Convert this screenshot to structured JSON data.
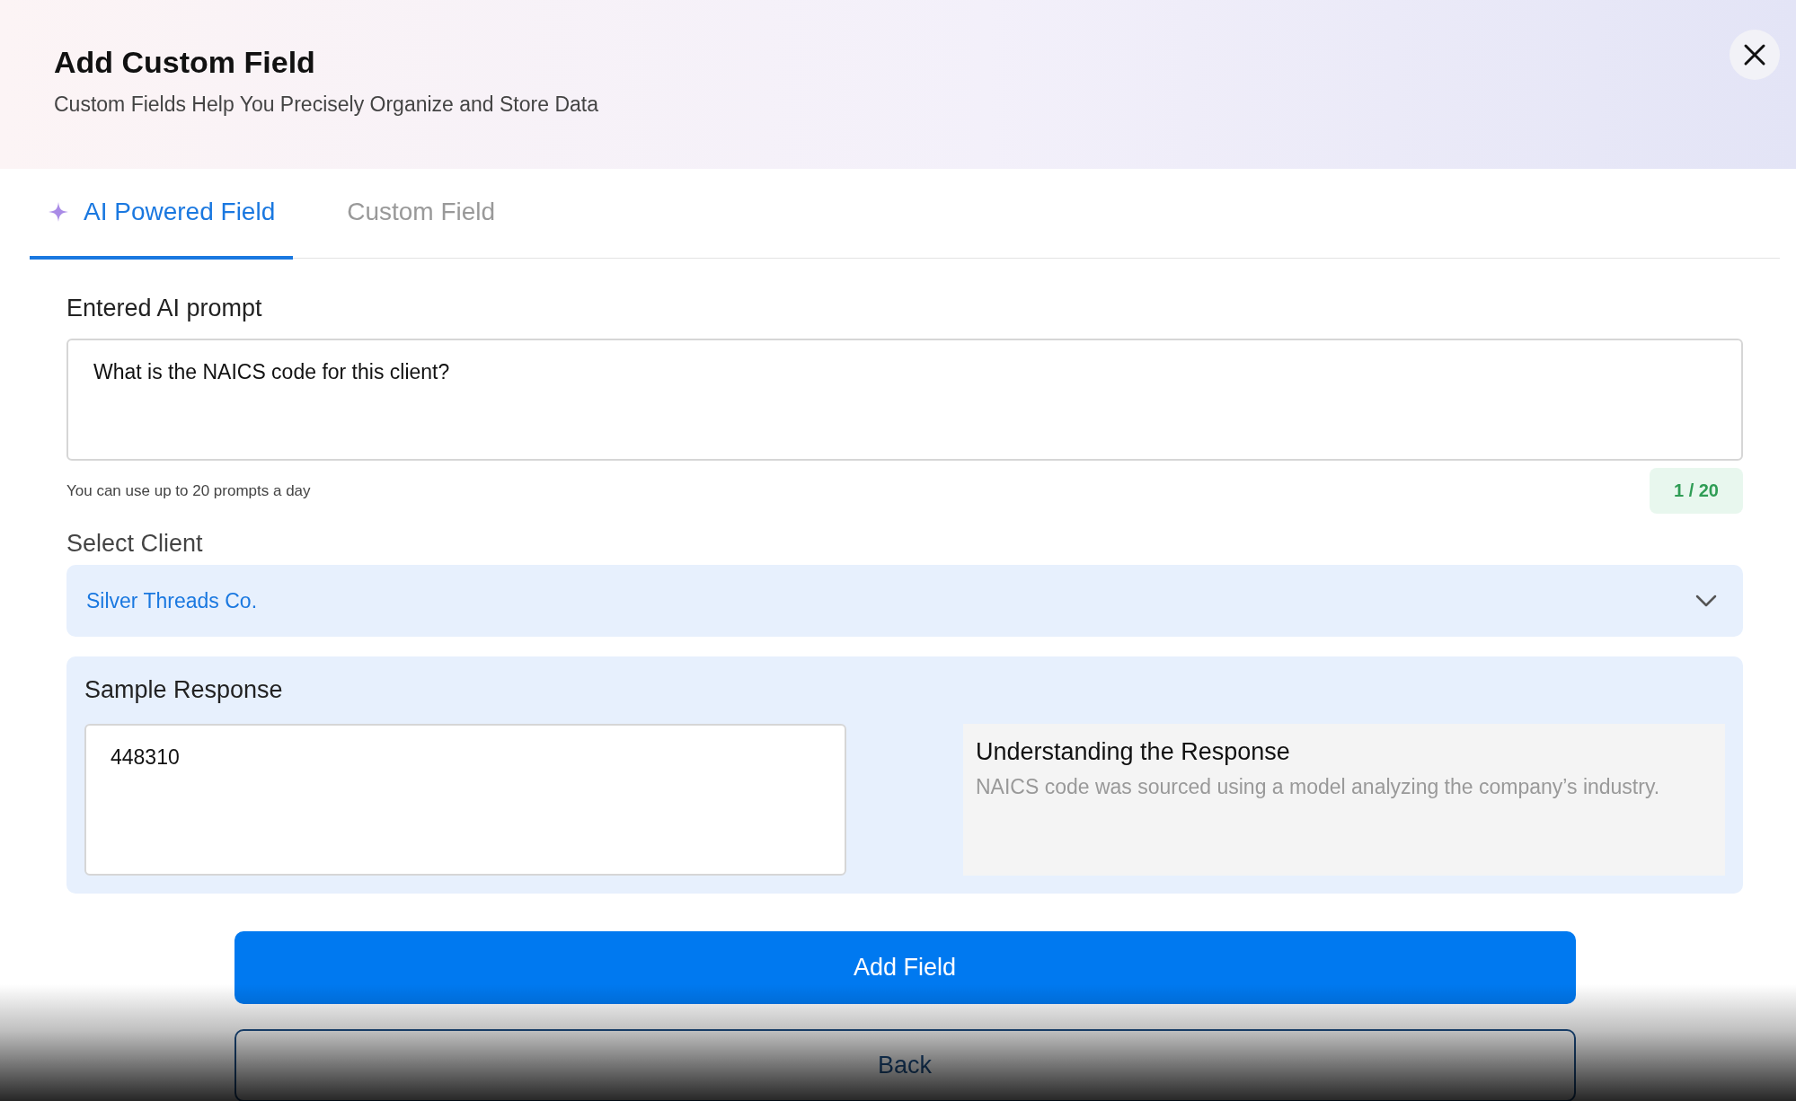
{
  "dialog": {
    "title": "Add Custom Field",
    "subtitle": "Custom Fields Help You Precisely Organize and Store Data"
  },
  "tabs": [
    {
      "label": "AI Powered Field",
      "kind": "ai",
      "selected": true
    },
    {
      "label": "Custom Field",
      "kind": "plain",
      "selected": false
    }
  ],
  "prompt": {
    "label": "Entered AI prompt",
    "value": "What is the NAICS code for this client?",
    "hint": "You can use up to 20 prompts a day",
    "counter": "1 / 20"
  },
  "client": {
    "label": "Select Client",
    "value": "Silver Threads Co."
  },
  "sample": {
    "title": "Sample Response",
    "value": "448310",
    "info_title": "Understanding the Response",
    "info_text": "NAICS code was sourced using a model analyzing the company’s industry."
  },
  "buttons": [
    {
      "label": "Add Field",
      "kind": "primary"
    },
    {
      "label": "Back",
      "kind": "outline"
    }
  ]
}
